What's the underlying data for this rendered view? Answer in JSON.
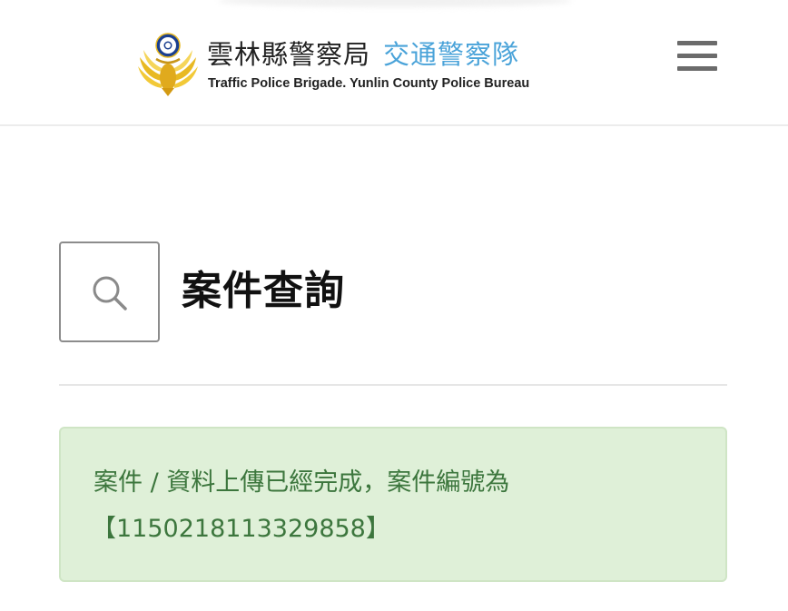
{
  "header": {
    "org_name": "雲林縣警察局",
    "unit_name": "交通警察隊",
    "subtitle": "Traffic Police Brigade. Yunlin County Police Bureau",
    "logo_icon": "police-emblem-icon",
    "menu_icon": "hamburger-menu-icon"
  },
  "main": {
    "title": "案件查詢",
    "title_icon": "search-icon"
  },
  "alert": {
    "message": "案件 / 資料上傳已經完成，案件編號為",
    "case_number": "【1150218113329858】",
    "text_color": "#3c763d",
    "background_color": "#dff0d8"
  },
  "colors": {
    "accent": "#4aa3d9",
    "menu": "#6b6b6b"
  }
}
